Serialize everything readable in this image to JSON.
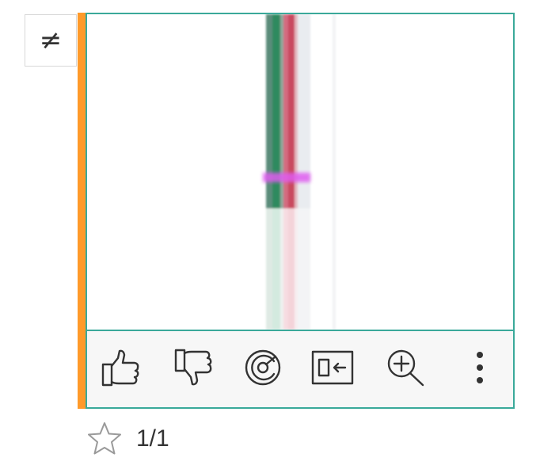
{
  "badge": {
    "symbol": "≠",
    "icon": "not-equal-icon"
  },
  "accent_color": "#ff9a2a",
  "frame_color": "#3aa99a",
  "toolbar": {
    "buttons": [
      {
        "name": "like-button",
        "icon": "thumbs-up-icon"
      },
      {
        "name": "dislike-button",
        "icon": "thumbs-down-icon"
      },
      {
        "name": "target-button",
        "icon": "target-icon"
      },
      {
        "name": "insert-button",
        "icon": "insert-left-icon"
      },
      {
        "name": "zoom-in-button",
        "icon": "zoom-in-icon"
      },
      {
        "name": "more-button",
        "icon": "more-vertical-icon"
      }
    ]
  },
  "footer": {
    "star_icon": "star-outline-icon",
    "counter": "1/1"
  }
}
